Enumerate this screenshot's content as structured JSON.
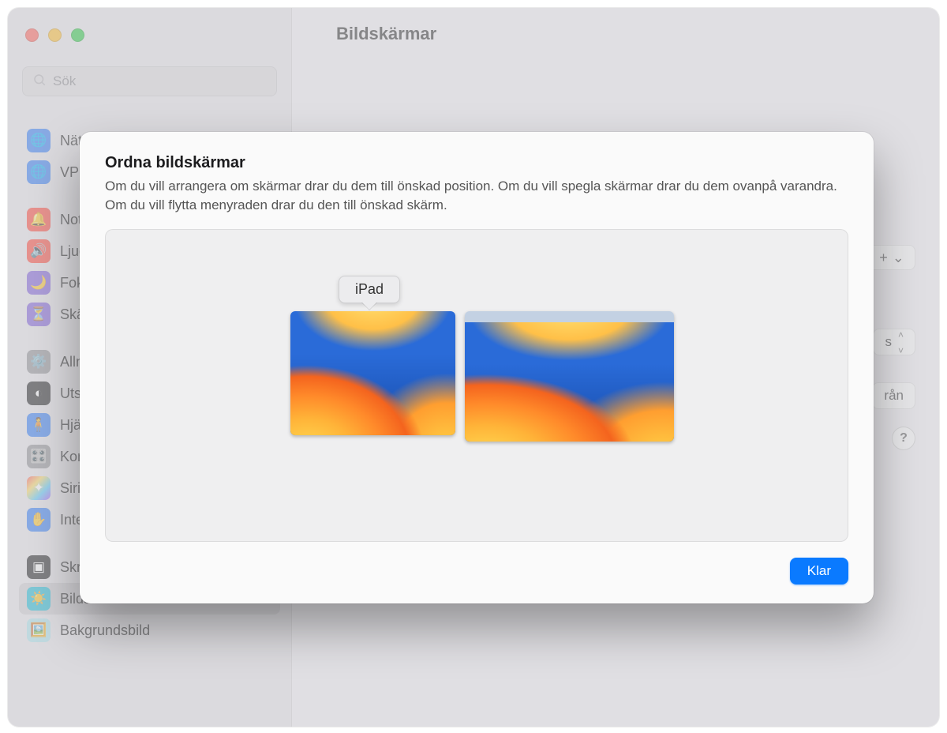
{
  "window": {
    "title": "Bildskärmar",
    "search_placeholder": "Sök"
  },
  "sidebar": {
    "group1": [
      {
        "label": "Nätverk",
        "iconClass": "ic-blue"
      },
      {
        "label": "VPN",
        "iconClass": "ic-blue"
      }
    ],
    "group2": [
      {
        "label": "Notiser",
        "iconClass": "ic-red"
      },
      {
        "label": "Ljud",
        "iconClass": "ic-red"
      },
      {
        "label": "Fokus",
        "iconClass": "ic-purple"
      },
      {
        "label": "Skärmtid",
        "iconClass": "ic-purple"
      }
    ],
    "group3": [
      {
        "label": "Allmänt",
        "iconClass": "ic-gray"
      },
      {
        "label": "Utseende",
        "iconClass": "ic-black"
      },
      {
        "label": "Hjälpmedel",
        "iconClass": "ic-blue"
      },
      {
        "label": "Kontrollcenter",
        "iconClass": "ic-gray"
      },
      {
        "label": "Siri och Spotlight",
        "iconClass": "ic-grad"
      },
      {
        "label": "Integritet och säkerhet",
        "iconClass": "ic-blue"
      }
    ],
    "group4": [
      {
        "label": "Skrivbord och Dock",
        "iconClass": "ic-black"
      },
      {
        "label": "Bildskärmar",
        "iconClass": "ic-teal",
        "selected": true
      },
      {
        "label": "Bakgrundsbild",
        "iconClass": "ic-mint"
      }
    ]
  },
  "main": {
    "add_button": "+",
    "chip1_suffix": "s",
    "chip2_suffix": "rån",
    "help": "?"
  },
  "sheet": {
    "title": "Ordna bildskärmar",
    "description": "Om du vill arrangera om skärmar drar du dem till önskad position. Om du vill spegla skärmar drar du dem ovanpå varandra. Om du vill flytta menyraden drar du den till önskad skärm.",
    "tooltip": "iPad",
    "done": "Klar"
  }
}
